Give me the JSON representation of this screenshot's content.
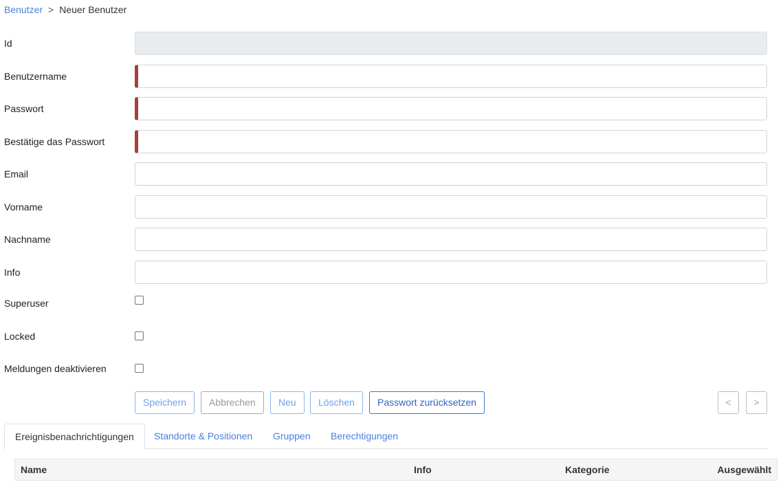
{
  "breadcrumb": {
    "parent": "Benutzer",
    "separator": ">",
    "current": "Neuer Benutzer"
  },
  "form": {
    "fields": [
      {
        "label": "Id",
        "value": "",
        "readonly": true,
        "required": false
      },
      {
        "label": "Benutzername",
        "value": "",
        "readonly": false,
        "required": true
      },
      {
        "label": "Passwort",
        "value": "",
        "readonly": false,
        "required": true
      },
      {
        "label": "Bestätige das Passwort",
        "value": "",
        "readonly": false,
        "required": true
      },
      {
        "label": "Email",
        "value": "",
        "readonly": false,
        "required": false
      },
      {
        "label": "Vorname",
        "value": "",
        "readonly": false,
        "required": false
      },
      {
        "label": "Nachname",
        "value": "",
        "readonly": false,
        "required": false
      },
      {
        "label": "Info",
        "value": "",
        "readonly": false,
        "required": false
      }
    ],
    "checkboxes": [
      {
        "label": "Superuser",
        "checked": false
      },
      {
        "label": "Locked",
        "checked": false
      },
      {
        "label": "Meldungen deaktivieren",
        "checked": false
      }
    ]
  },
  "actions": {
    "save": "Speichern",
    "cancel": "Abbrechen",
    "new": "Neu",
    "delete": "Löschen",
    "reset_password": "Passwort zurücksetzen",
    "prev": "<",
    "next": ">"
  },
  "tabs": [
    {
      "label": "Ereignisbenachrichtigungen",
      "active": true
    },
    {
      "label": "Standorte & Positionen",
      "active": false
    },
    {
      "label": "Gruppen",
      "active": false
    },
    {
      "label": "Berechtigungen",
      "active": false
    }
  ],
  "table": {
    "columns": [
      "Name",
      "Info",
      "Kategorie",
      "Ausgewählt"
    ]
  },
  "colors": {
    "link": "#4a7fe0",
    "required_marker": "#a5403a",
    "readonly_bg": "#e9ecef"
  }
}
